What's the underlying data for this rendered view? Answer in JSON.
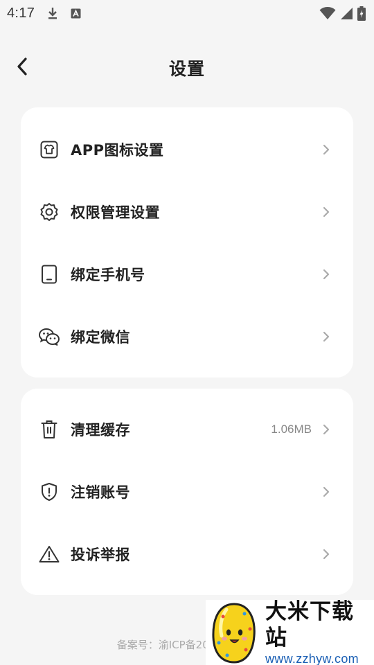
{
  "status_bar": {
    "time": "4:17",
    "left_icons": [
      "download-icon",
      "keyboard-a-icon"
    ],
    "right_icons": [
      "wifi-icon",
      "signal-icon",
      "battery-charging-icon"
    ]
  },
  "header": {
    "title": "设置",
    "back_icon": "chevron-left-icon"
  },
  "settings_group_1": [
    {
      "icon": "app-icon-shirt-icon",
      "label": "APP图标设置"
    },
    {
      "icon": "gear-icon",
      "label": "权限管理设置"
    },
    {
      "icon": "phone-icon",
      "label": "绑定手机号"
    },
    {
      "icon": "wechat-icon",
      "label": "绑定微信"
    }
  ],
  "settings_group_2": [
    {
      "icon": "trash-icon",
      "label": "清理缓存",
      "value": "1.06MB"
    },
    {
      "icon": "shield-icon",
      "label": "注销账号"
    },
    {
      "icon": "warning-icon",
      "label": "投诉举报"
    }
  ],
  "footer": {
    "icp_text": "备案号：渝ICP备200"
  },
  "watermark": {
    "title": "大米下载站",
    "url": "www.zzhyw.com"
  },
  "colors": {
    "background": "#f5f5f5",
    "card": "#ffffff",
    "text": "#222222",
    "muted": "#888888",
    "footer": "#aaaaaa",
    "watermark_url": "#1a5fb4"
  }
}
